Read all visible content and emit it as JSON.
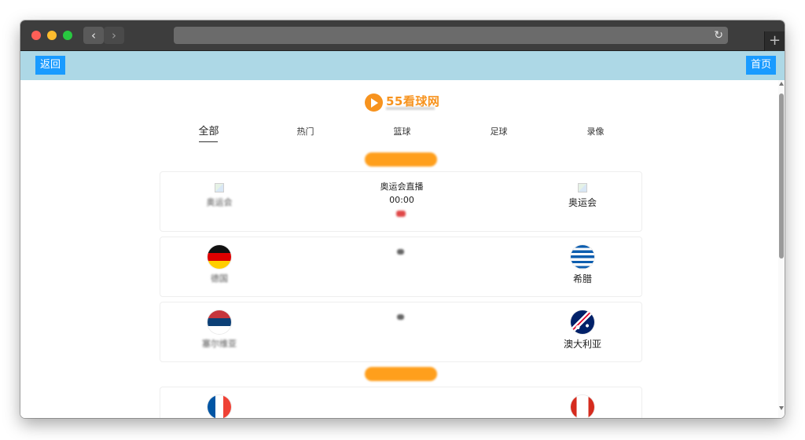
{
  "browser": {
    "nav_back_icon": "chevron-left-icon",
    "nav_back_glyph": "‹",
    "nav_forward_glyph": "›",
    "reload_glyph": "↻",
    "new_tab_glyph": "+"
  },
  "topbar": {
    "back_label": "返回",
    "home_label": "首页",
    "color": "#add8e6",
    "button_color": "#1a9bff"
  },
  "logo": {
    "text": "55看球网",
    "color": "#f7931e"
  },
  "tabs": [
    {
      "label": "全部",
      "active": true
    },
    {
      "label": "热门"
    },
    {
      "label": "篮球"
    },
    {
      "label": "足球"
    },
    {
      "label": "录像"
    }
  ],
  "date_pills": [
    "",
    ""
  ],
  "matches": [
    {
      "home": {
        "name": "奥运会",
        "flag": "broken-image",
        "name_blurred": true
      },
      "away": {
        "name": "奥运会",
        "flag": "broken-image",
        "name_blurred": false
      },
      "event": "奥运会直播",
      "time": "00:00",
      "status": "",
      "event_blurred": false
    },
    {
      "home": {
        "name": "德国",
        "flag": "germany-flag",
        "name_blurred": true
      },
      "away": {
        "name": "希腊",
        "flag": "greece-flag",
        "name_blurred": false
      },
      "event": "",
      "time": "",
      "status": "",
      "event_blurred": true
    },
    {
      "home": {
        "name": "塞尔维亚",
        "flag": "serbia-flag",
        "name_blurred": true
      },
      "away": {
        "name": "澳大利亚",
        "flag": "australia-flag",
        "name_blurred": false
      },
      "event": "",
      "time": "",
      "status": "",
      "event_blurred": true
    },
    {
      "home": {
        "name": "",
        "flag": "france-flag",
        "name_blurred": true
      },
      "away": {
        "name": "",
        "flag": "canada-flag",
        "name_blurred": false
      },
      "event": "",
      "time": "",
      "status": "",
      "event_blurred": true
    }
  ]
}
